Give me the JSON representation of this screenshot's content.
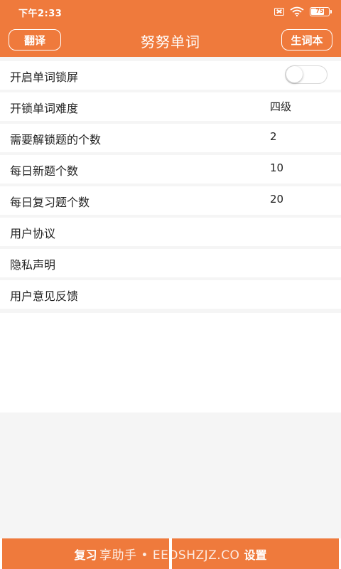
{
  "status_bar": {
    "time": "下午2:33",
    "battery_level": 75,
    "battery_label": "75",
    "icons": [
      "sim-icon",
      "wifi-icon",
      "battery-icon"
    ]
  },
  "header": {
    "title": "努努单词",
    "left_button": "翻译",
    "right_button": "生词本"
  },
  "settings": {
    "lock_screen": {
      "label": "开启单词锁屏",
      "enabled": false
    },
    "difficulty": {
      "label": "开锁单词难度",
      "value": "四级"
    },
    "unlock_count": {
      "label": "需要解锁题的个数",
      "value": "2"
    },
    "daily_new": {
      "label": "每日新题个数",
      "value": "10"
    },
    "daily_review": {
      "label": "每日复习题个数",
      "value": "20"
    },
    "user_agreement": {
      "label": "用户协议"
    },
    "privacy": {
      "label": "隐私声明"
    },
    "feedback": {
      "label": "用户意见反馈"
    }
  },
  "tabs": {
    "review": "复习",
    "settings": "设置"
  },
  "watermark": "享助手 • EEDSHZJZ.CO",
  "colors": {
    "accent": "#ef7a3c",
    "background": "#f5f5f5",
    "row": "#ffffff",
    "text": "#222222"
  }
}
